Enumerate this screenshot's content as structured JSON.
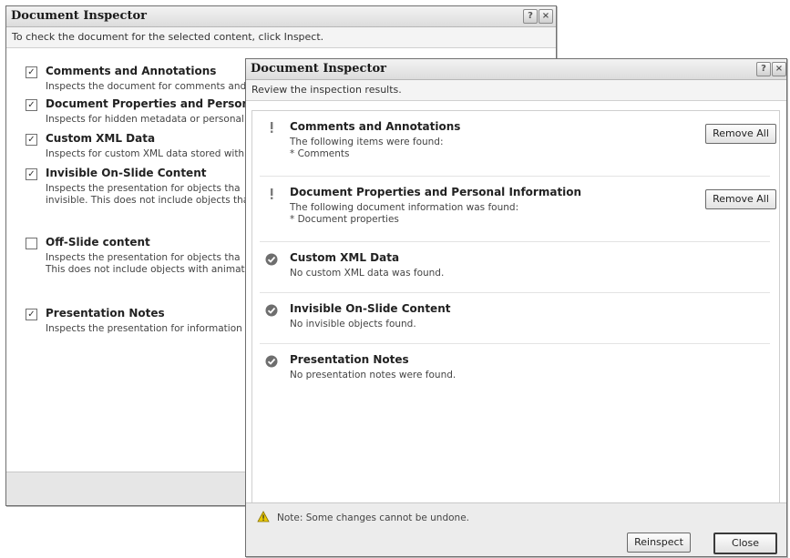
{
  "back_window": {
    "title": "Document Inspector",
    "instruction": "To check the document for the selected content, click Inspect.",
    "items": [
      {
        "title": "Comments and Annotations",
        "checked": true,
        "desc": [
          "Inspects the document for comments and"
        ]
      },
      {
        "title": "Document Properties and Personal",
        "checked": true,
        "desc": [
          "Inspects for hidden metadata or personal"
        ]
      },
      {
        "title": "Custom XML Data",
        "checked": true,
        "desc": [
          "Inspects for custom XML data stored with"
        ]
      },
      {
        "title": "Invisible On-Slide Content",
        "checked": true,
        "desc": [
          "Inspects the presentation for objects tha",
          "invisible. This does not include objects tha"
        ]
      },
      {
        "title": "Off-Slide content",
        "checked": false,
        "desc": [
          "Inspects the presentation for objects tha",
          "This does not include objects with animati"
        ]
      },
      {
        "title": "Presentation Notes",
        "checked": true,
        "desc": [
          "Inspects the presentation for information"
        ]
      }
    ]
  },
  "front_window": {
    "title": "Document Inspector",
    "subtitle": "Review the inspection results.",
    "results": [
      {
        "title": "Comments and Annotations",
        "status": "found",
        "line1": "The following items were found:",
        "line2": "* Comments",
        "button": "Remove All"
      },
      {
        "title": "Document Properties and Personal Information",
        "status": "found",
        "line1": "The following document information was found:",
        "line2": "* Document properties",
        "button": "Remove All"
      },
      {
        "title": "Custom XML Data",
        "status": "clean",
        "line1": "No custom XML data was found."
      },
      {
        "title": "Invisible On-Slide Content",
        "status": "clean",
        "line1": "No invisible objects found."
      },
      {
        "title": "Presentation Notes",
        "status": "clean",
        "line1": "No presentation notes were found."
      }
    ],
    "note": "Note: Some changes cannot be undone.",
    "reinspect_label": "Reinspect",
    "close_label": "Close"
  },
  "title_buttons": {
    "help": "?",
    "close": "×"
  },
  "colors": {
    "check_ok": "#6e6e6e",
    "found": "#7a7a7a",
    "warn": "#d9b400"
  }
}
